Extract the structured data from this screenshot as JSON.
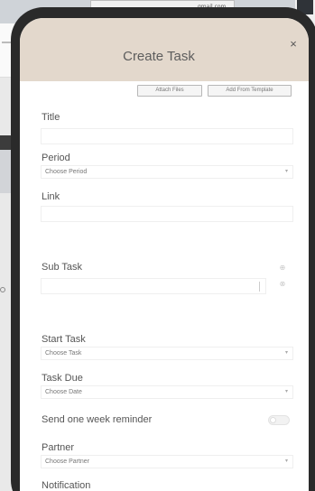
{
  "background": {
    "tiny_text": "gmail.com"
  },
  "modal": {
    "title": "Create Task",
    "close_glyph": "×"
  },
  "toolbar": {
    "attach_label": "Attach Files",
    "template_label": "Add From Template"
  },
  "fields": {
    "title_label": "Title",
    "period_label": "Period",
    "period_placeholder": "Choose Period",
    "link_label": "Link",
    "subtask_label": "Sub Task",
    "start_label": "Start Task",
    "start_placeholder": "Choose Task",
    "due_label": "Task Due",
    "due_placeholder": "Choose Date",
    "reminder_label": "Send one week reminder",
    "partner_label": "Partner",
    "partner_placeholder": "Choose Partner",
    "notification_label": "Notification"
  },
  "icons": {
    "caret": "▾",
    "add": "⊕",
    "remove": "⊗"
  },
  "colors": {
    "header": "#e3d8cc",
    "phone_frame": "#2a2a2a"
  }
}
